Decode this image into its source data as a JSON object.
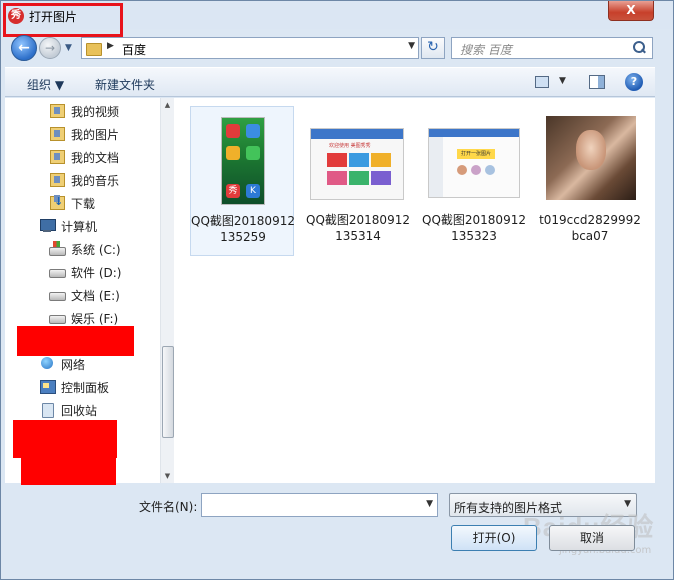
{
  "window": {
    "title": "打开图片",
    "close_label": "X"
  },
  "nav": {
    "back_label": "←",
    "forward_label": "→",
    "history_label": "▼",
    "address_arrow": "▶",
    "address_path": "百度",
    "address_drop": "▼",
    "refresh_label": "↻",
    "search_placeholder": "搜索 百度"
  },
  "toolbar": {
    "organize_label": "组织 ▼",
    "new_folder_label": "新建文件夹",
    "view_drop": "▼",
    "help_label": "?"
  },
  "sidebar": {
    "items": [
      {
        "label": "我的视频",
        "icon": "folder-icon"
      },
      {
        "label": "我的图片",
        "icon": "folder-icon"
      },
      {
        "label": "我的文档",
        "icon": "folder-icon"
      },
      {
        "label": "我的音乐",
        "icon": "folder-icon"
      },
      {
        "label": "下载",
        "icon": "download-folder-icon"
      },
      {
        "label": "计算机",
        "icon": "computer-icon"
      },
      {
        "label": "系统 (C:)",
        "icon": "system-drive-icon"
      },
      {
        "label": "软件 (D:)",
        "icon": "drive-icon"
      },
      {
        "label": "文档 (E:)",
        "icon": "drive-icon"
      },
      {
        "label": "娱乐 (F:)",
        "icon": "drive-icon"
      },
      {
        "label": "网络",
        "icon": "network-icon"
      },
      {
        "label": "控制面板",
        "icon": "control-panel-icon"
      },
      {
        "label": "回收站",
        "icon": "recycle-bin-icon"
      }
    ],
    "scroll_up": "▲",
    "scroll_down": "▼"
  },
  "files": [
    {
      "name": "QQ截图20180912135259",
      "selected": true
    },
    {
      "name": "QQ截图20180912135314",
      "selected": false
    },
    {
      "name": "QQ截图20180912135323",
      "selected": false
    },
    {
      "name": "t019ccd2829992bca07",
      "selected": false
    }
  ],
  "thumb_text": {
    "th1_tile1": "秀",
    "th1_tile2": "K",
    "th2_header": "欢迎使用 美图秀秀",
    "th3_button": "打开一张图片"
  },
  "bottom": {
    "filename_label": "文件名(N):",
    "filename_value": "",
    "filename_drop": "▼",
    "filetype_value": "所有支持的图片格式",
    "filetype_drop": "▼",
    "open_label": "打开(O)",
    "cancel_label": "取消"
  },
  "watermark": {
    "logo_text": "Baidu经验",
    "sub_text": "jingyan.baidu.com"
  },
  "colors": {
    "highlight_border": "#e8131b",
    "redaction": "#ff0000",
    "chrome": "#dce7f3"
  }
}
